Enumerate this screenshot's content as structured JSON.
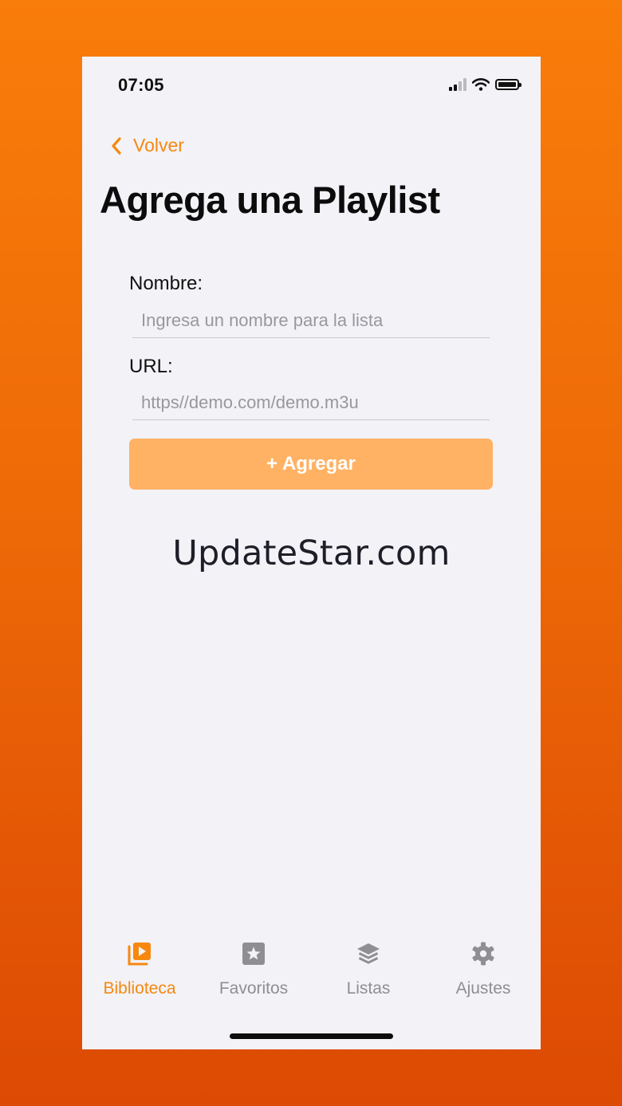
{
  "status_bar": {
    "time": "07:05",
    "signal_icon": "cellular-signal-icon",
    "wifi_icon": "wifi-icon",
    "battery_icon": "battery-icon"
  },
  "nav": {
    "back_label": "Volver",
    "back_icon": "chevron-left-icon"
  },
  "page": {
    "title": "Agrega una Playlist"
  },
  "form": {
    "name_label": "Nombre:",
    "name_placeholder": "Ingresa un nombre para la lista",
    "name_value": "",
    "url_label": "URL:",
    "url_placeholder": "https//demo.com/demo.m3u",
    "url_value": "",
    "submit_label": "+ Agregar"
  },
  "watermark": "UpdateStar.com",
  "tab_bar": {
    "items": [
      {
        "label": "Biblioteca",
        "icon": "library-play-icon",
        "active": true
      },
      {
        "label": "Favoritos",
        "icon": "star-square-icon",
        "active": false
      },
      {
        "label": "Listas",
        "icon": "layers-stack-icon",
        "active": false
      },
      {
        "label": "Ajustes",
        "icon": "gear-icon",
        "active": false
      }
    ]
  },
  "colors": {
    "accent": "#f7880f",
    "button_fill": "#ffb264",
    "inactive": "#8e8e93",
    "screen_bg": "#f2f2f7",
    "outer_bg_top": "#f97d0a",
    "outer_bg_bottom": "#dd4a04"
  }
}
